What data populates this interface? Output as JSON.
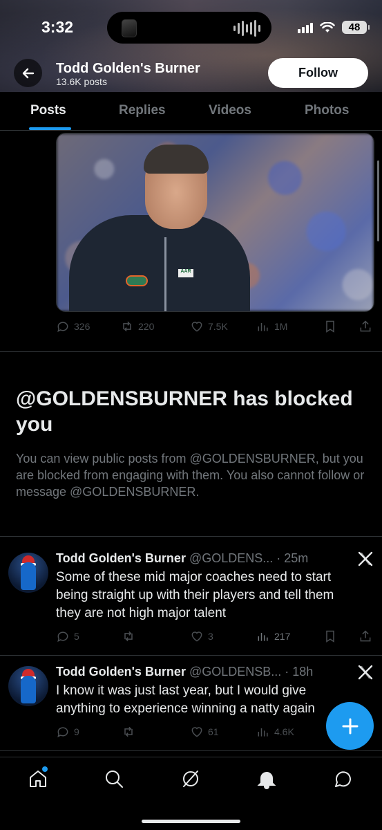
{
  "status_bar": {
    "time": "3:32",
    "battery": "48"
  },
  "profile": {
    "name": "Todd Golden's Burner",
    "post_count": "13.6K posts",
    "follow_label": "Follow"
  },
  "tabs": [
    {
      "label": "Posts",
      "active": true
    },
    {
      "label": "Replies",
      "active": false
    },
    {
      "label": "Videos",
      "active": false
    },
    {
      "label": "Photos",
      "active": false
    }
  ],
  "image_post": {
    "replies": "326",
    "reposts": "220",
    "likes": "7.5K",
    "views": "1M",
    "patch_text": "AAR"
  },
  "blocked": {
    "title": "@GOLDENSBURNER has blocked you",
    "description": "You can view public posts from @GOLDENSBURNER, but you are blocked from engaging with them. You also cannot follow or message @GOLDENSBURNER."
  },
  "tweets": [
    {
      "name": "Todd Golden's Burner",
      "handle": "@GOLDENS... · 25m",
      "text": "Some of these mid major coaches need to start being straight up with their players and tell them they are not high major talent",
      "replies": "5",
      "reposts": "",
      "likes": "3",
      "views": "217"
    },
    {
      "name": "Todd Golden's Burner",
      "handle": "@GOLDENSB... · 18h",
      "text": "I know it was just last year, but I would give anything to experience winning a natty again",
      "replies": "9",
      "reposts": "",
      "likes": "61",
      "views": "4.6K"
    }
  ],
  "colors": {
    "accent": "#1d9bf0",
    "background": "#000000",
    "secondary_text": "#71767b",
    "divider": "#2f3336"
  },
  "icons": {
    "back": "arrow-left-icon",
    "reply": "speech-bubble-icon",
    "repost": "repost-icon",
    "like": "heart-icon",
    "views": "bar-chart-icon",
    "bookmark": "bookmark-icon",
    "share": "share-icon",
    "compose": "plus-icon",
    "nav": [
      "home-icon",
      "search-icon",
      "grok-icon",
      "bell-icon",
      "message-icon"
    ]
  }
}
